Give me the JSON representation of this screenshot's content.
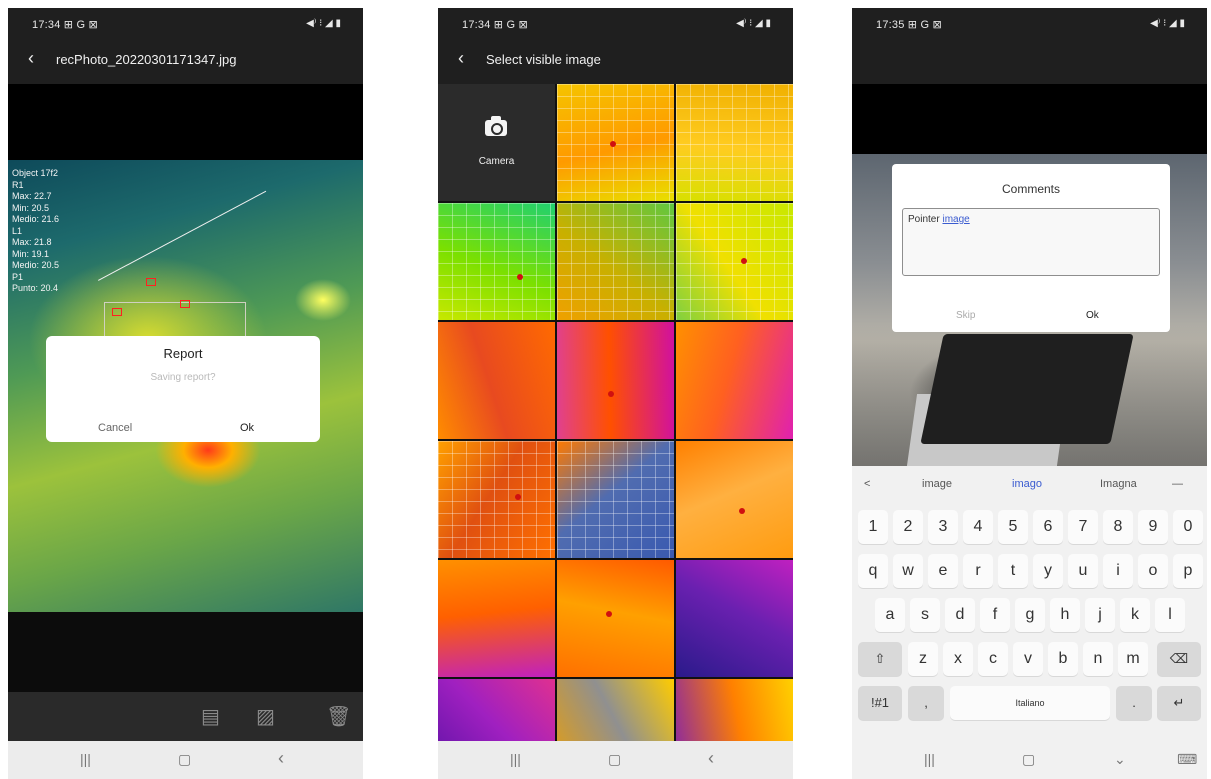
{
  "phone1": {
    "status_time": "17:34 ⊞ G ⊠",
    "status_icons": "◀⁾ ⁝ ◢ ▮",
    "back_icon": "back-arrow-icon",
    "title": "recPhoto_20220301171347.jpg",
    "readout": [
      "Object 17f2",
      "R1",
      "Max: 22.7",
      "Min: 20.5",
      "Medio: 21.6",
      "L1",
      "Max: 21.8",
      "Min: 19.1",
      "Medio: 20.5",
      "P1",
      "Punto: 20.4"
    ],
    "dialog": {
      "title": "Report",
      "message": "Saving report?",
      "cancel": "Cancel",
      "ok": "Ok"
    },
    "toolbar_icons": [
      "report-icon",
      "export-image-icon",
      "delete-icon"
    ]
  },
  "phone2": {
    "status_time": "17:34 ⊞ G ⊠",
    "status_icons": "◀⁾ ⁝ ◢ ▮",
    "title": "Select visible image",
    "camera_label": "Camera"
  },
  "phone3": {
    "status_time": "17:35 ⊞ G ⊠",
    "status_icons": "◀⁾ ⁝ ◢ ▮",
    "dialog": {
      "title": "Comments",
      "comment_word1": "Pointer",
      "comment_word2": "image",
      "skip": "Skip",
      "ok": "Ok"
    },
    "keyboard": {
      "suggestions": [
        "<",
        "image",
        "imago",
        "Imagna",
        "—"
      ],
      "row_numbers": [
        "1",
        "2",
        "3",
        "4",
        "5",
        "6",
        "7",
        "8",
        "9",
        "0"
      ],
      "row_q": [
        "q",
        "w",
        "e",
        "r",
        "t",
        "y",
        "u",
        "i",
        "o",
        "p"
      ],
      "row_a": [
        "a",
        "s",
        "d",
        "f",
        "g",
        "h",
        "j",
        "k",
        "l"
      ],
      "row_z": [
        "z",
        "x",
        "c",
        "v",
        "b",
        "n",
        "m"
      ],
      "shift": "⇧",
      "backspace": "⌫",
      "symbols": "!#1",
      "comma": ",",
      "space": "Italiano",
      "period": ".",
      "enter": "↵"
    },
    "nav": {
      "recents": "|||",
      "home": "▢",
      "hide_keyboard": "⌄",
      "keyboard_menu": "⌨"
    }
  },
  "navbar": {
    "recents": "|||",
    "home": "▢",
    "back": "‹"
  }
}
